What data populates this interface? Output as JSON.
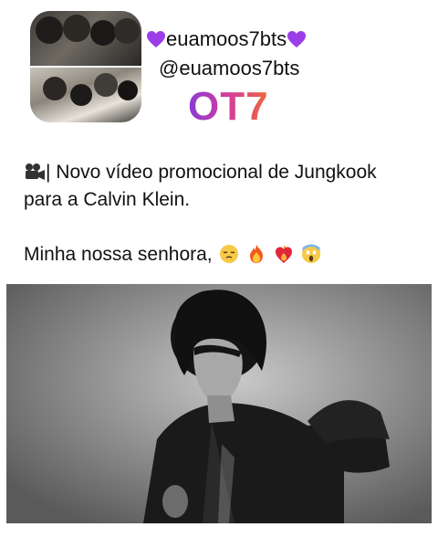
{
  "profile": {
    "display_name": "euamoos7bts",
    "handle": "@euamoos7bts",
    "badge_text": "OT7",
    "heart_color": "#9b3ee8"
  },
  "post": {
    "camera_icon": "video-camera-icon",
    "line1": "| Novo vídeo promocional de Jungkook",
    "line2": "para a Calvin Klein.",
    "line3": "Minha nossa senhora,",
    "emojis": [
      "relieved-face-icon",
      "fire-icon",
      "heart-on-fire-icon",
      "screaming-face-icon"
    ]
  },
  "colors": {
    "badge_gradient": [
      "#8a3bd6",
      "#d43d9b",
      "#ef6a3a"
    ],
    "video_tone": "#8a8a8a"
  }
}
